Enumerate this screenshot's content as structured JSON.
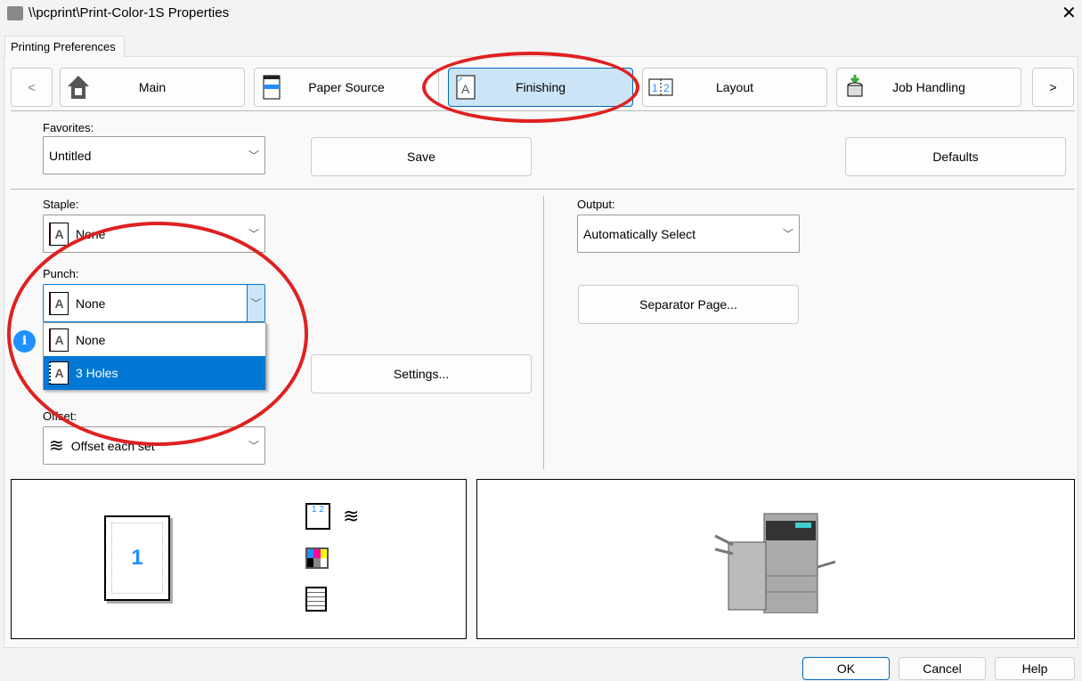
{
  "window": {
    "title": "\\\\pcprint\\Print-Color-1S Properties",
    "close": "✕"
  },
  "tab": "Printing Preferences",
  "nav": {
    "prev": "<",
    "next": ">",
    "items": [
      {
        "label": "Main",
        "icon": "home-icon"
      },
      {
        "label": "Paper Source",
        "icon": "printer-tray-icon"
      },
      {
        "label": "Finishing",
        "icon": "finishing-icon",
        "selected": true
      },
      {
        "label": "Layout",
        "icon": "layout-icon"
      },
      {
        "label": "Job Handling",
        "icon": "job-handling-icon"
      }
    ]
  },
  "favorites": {
    "label": "Favorites:",
    "value": "Untitled",
    "save": "Save",
    "defaults": "Defaults"
  },
  "staple": {
    "label": "Staple:",
    "value": "None"
  },
  "punch": {
    "label": "Punch:",
    "value": "None",
    "options": [
      "None",
      "3 Holes"
    ],
    "highlighted": "3 Holes"
  },
  "settings": "Settings...",
  "offset": {
    "label": "Offset:",
    "value": "Offset each set"
  },
  "output": {
    "label": "Output:",
    "value": "Automatically Select",
    "separator": "Separator Page..."
  },
  "preview": {
    "page_number": "1",
    "page_icon_text": "1",
    "collate_text": "1 2"
  },
  "colors": {
    "accent": "#0078d4",
    "selected_tab": "#cce4f7",
    "annotation": "#e02020"
  },
  "footer": {
    "ok": "OK",
    "cancel": "Cancel",
    "help": "Help"
  }
}
